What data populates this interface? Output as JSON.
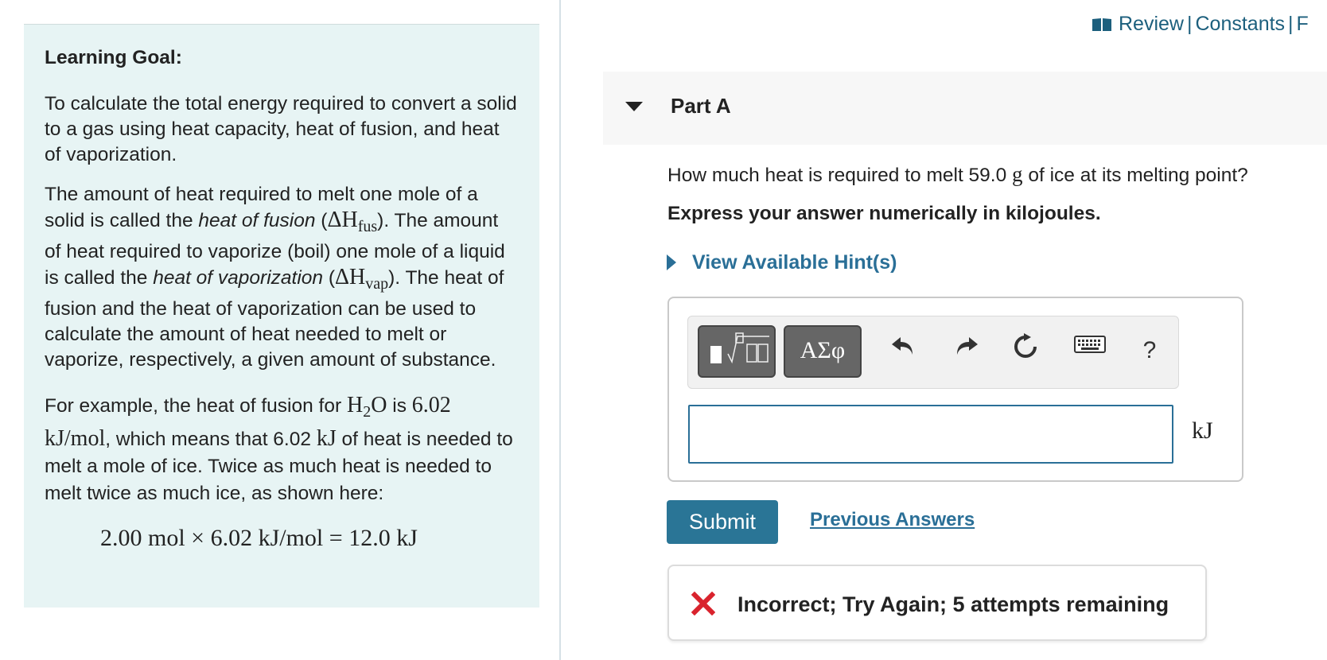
{
  "top_links": {
    "review": "Review",
    "separator": "|",
    "constants": "Constants",
    "periodic_table_partial": "F"
  },
  "learning_goal": {
    "title": "Learning Goal:",
    "paragraph1": "To calculate the total energy required to convert a solid to a gas using heat capacity, heat of fusion, and heat of vaporization.",
    "p2": {
      "a": "The amount of heat required to melt one mole of a solid is called the ",
      "heat_of_fusion": "heat of fusion",
      "b": " (",
      "delta": "ΔH",
      "fus": "fus",
      "c": "). The amount of heat required to vaporize (boil) one mole of a liquid is called the ",
      "heat_of_vaporization": "heat of vaporization",
      "d": " (",
      "vap": "vap",
      "e": "). The heat of fusion and the heat of vaporization can be used to calculate the amount of heat needed to melt or vaporize, respectively, a given amount of substance."
    },
    "p3": {
      "a": "For example, the heat of fusion for ",
      "h": "H",
      "two": "2",
      "o": "O",
      "b": " is ",
      "value": "6.02 kJ/mol",
      "c": ", which means that 6.02 ",
      "kj": "kJ",
      "d": " of heat is needed to melt a mole of ice. Twice as much heat is needed to melt twice as much ice, as shown here:"
    },
    "equation": "2.00 mol × 6.02 kJ/mol = 12.0 kJ"
  },
  "part": {
    "title": "Part A",
    "question_a": "How much heat is required to melt 59.0 ",
    "question_unit": "g",
    "question_b": " of ice at its melting point?",
    "instruction": "Express your answer numerically in kilojoules.",
    "hint_label": "View Available Hint(s)"
  },
  "answer": {
    "toolbar": {
      "greek_label": "ΑΣφ",
      "help_label": "?"
    },
    "input_value": "",
    "unit": "kJ"
  },
  "actions": {
    "submit_label": "Submit",
    "previous_answers_label": "Previous Answers"
  },
  "feedback": {
    "status": "Incorrect; Try Again; 5 attempts remaining",
    "error_color": "#d9232d"
  },
  "colors": {
    "accent": "#2a7596",
    "link": "#2a6f97",
    "panel_bg": "#e7f4f4"
  }
}
